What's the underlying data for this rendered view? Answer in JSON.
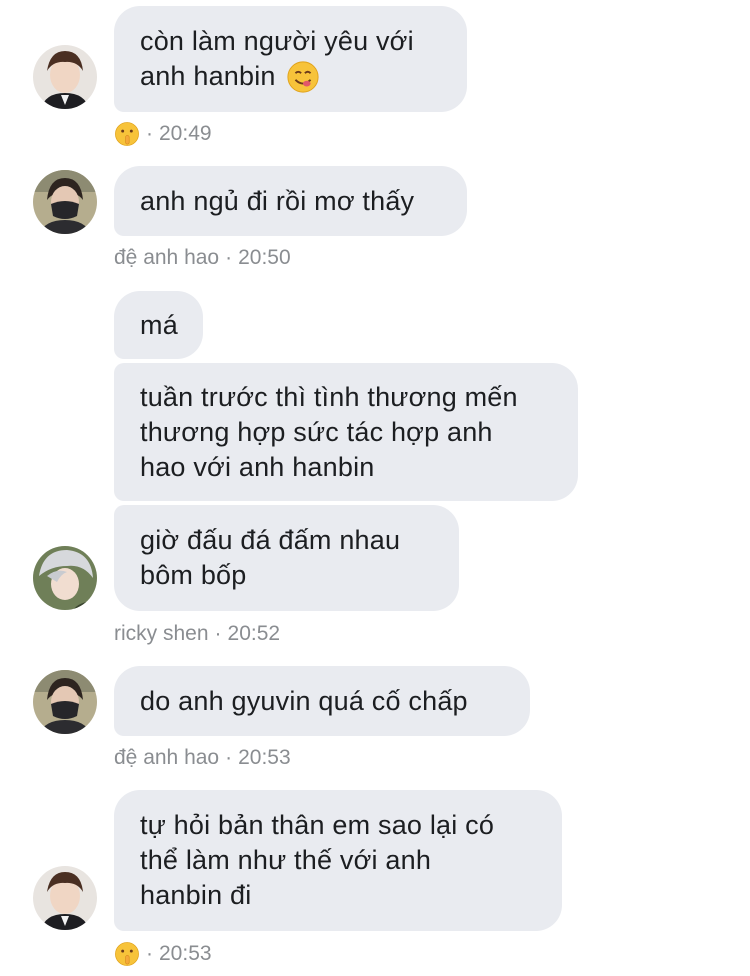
{
  "messages": [
    {
      "text": "còn làm người yêu với\nanh hanbin",
      "emoji": "yum-face-icon"
    },
    {
      "text": "anh ngủ đi rồi mơ thấy"
    },
    {
      "text": "má"
    },
    {
      "text": "tuần trước thì tình thương mến\nthương hợp sức tác hợp anh\nhao với anh hanbin"
    },
    {
      "text": "giờ đấu đá đấm nhau\nbôm bốp"
    },
    {
      "text": "do anh gyuvin quá cố chấp"
    },
    {
      "text": "tự hỏi bản thân em sao lại có\nthể làm như thế với anh\nhanbin đi"
    }
  ],
  "meta": [
    {
      "sender_emoji": "shushing-face-icon",
      "separator": "·",
      "time": "20:49"
    },
    {
      "sender": "đệ anh hao",
      "separator": "·",
      "time": "20:50"
    },
    {
      "sender": "ricky shen",
      "separator": "·",
      "time": "20:52"
    },
    {
      "sender": "đệ anh hao",
      "separator": "·",
      "time": "20:53"
    },
    {
      "sender_emoji": "shushing-face-icon",
      "separator": "·",
      "time": "20:53"
    }
  ],
  "colors": {
    "bubble": "#e9ebf0",
    "text": "#1c1e21",
    "meta": "#8a8d91"
  }
}
